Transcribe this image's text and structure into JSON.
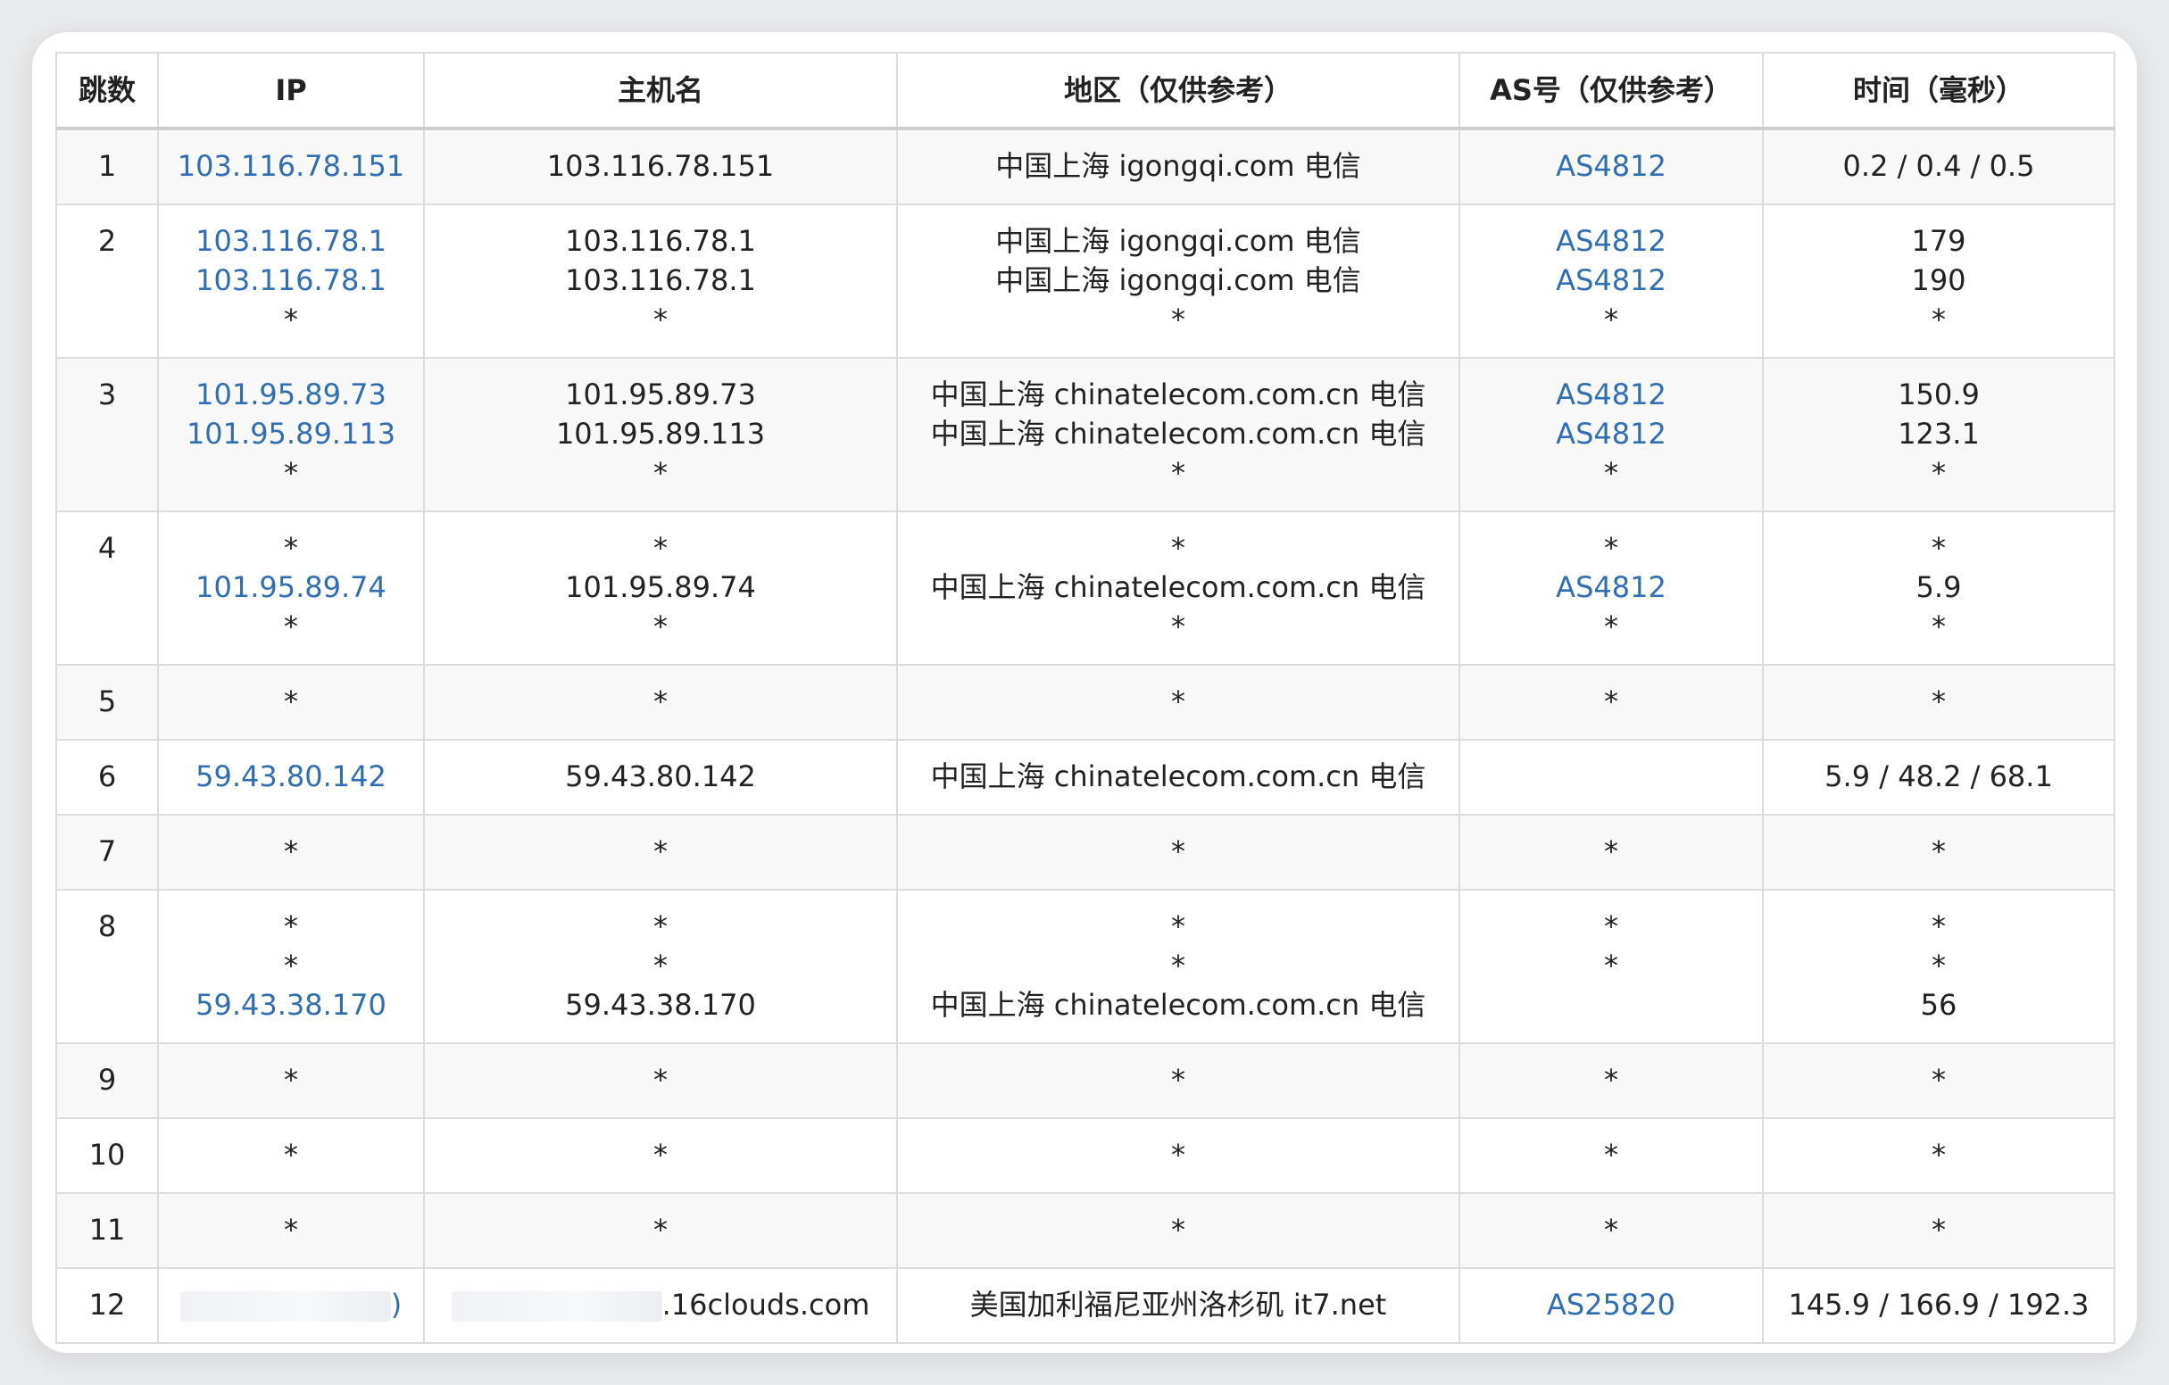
{
  "headers": {
    "hop": "跳数",
    "ip": "IP",
    "hostname": "主机名",
    "region": "地区（仅供参考）",
    "as": "AS号（仅供参考）",
    "time": "时间（毫秒）"
  },
  "rows": [
    {
      "hop": "1",
      "lines": 1,
      "ip": [
        "103.116.78.151"
      ],
      "host": [
        "103.116.78.151"
      ],
      "region": [
        "中国上海 igongqi.com 电信"
      ],
      "as": [
        "AS4812"
      ],
      "time": [
        "0.2 / 0.4 / 0.5"
      ]
    },
    {
      "hop": "2",
      "lines": 3,
      "ip": [
        "103.116.78.1",
        "103.116.78.1",
        "*"
      ],
      "host": [
        "103.116.78.1",
        "103.116.78.1",
        "*"
      ],
      "region": [
        "中国上海 igongqi.com 电信",
        "中国上海 igongqi.com 电信",
        "*"
      ],
      "as": [
        "AS4812",
        "AS4812",
        "*"
      ],
      "time": [
        "179",
        "190",
        "*"
      ]
    },
    {
      "hop": "3",
      "lines": 3,
      "ip": [
        "101.95.89.73",
        "101.95.89.113",
        "*"
      ],
      "host": [
        "101.95.89.73",
        "101.95.89.113",
        "*"
      ],
      "region": [
        "中国上海 chinatelecom.com.cn 电信",
        "中国上海 chinatelecom.com.cn 电信",
        "*"
      ],
      "as": [
        "AS4812",
        "AS4812",
        "*"
      ],
      "time": [
        "150.9",
        "123.1",
        "*"
      ]
    },
    {
      "hop": "4",
      "lines": 3,
      "ip": [
        "*",
        "101.95.89.74",
        "*"
      ],
      "host": [
        "*",
        "101.95.89.74",
        "*"
      ],
      "region": [
        "*",
        "中国上海 chinatelecom.com.cn 电信",
        "*"
      ],
      "as": [
        "*",
        "AS4812",
        "*"
      ],
      "time": [
        "*",
        "5.9",
        "*"
      ]
    },
    {
      "hop": "5",
      "lines": 1,
      "ip": [
        "*"
      ],
      "host": [
        "*"
      ],
      "region": [
        "*"
      ],
      "as": [
        "*"
      ],
      "time": [
        "*"
      ]
    },
    {
      "hop": "6",
      "lines": 1,
      "ip": [
        "59.43.80.142"
      ],
      "host": [
        "59.43.80.142"
      ],
      "region": [
        "中国上海 chinatelecom.com.cn 电信"
      ],
      "as": [
        ""
      ],
      "time": [
        "5.9 / 48.2 / 68.1"
      ]
    },
    {
      "hop": "7",
      "lines": 1,
      "ip": [
        "*"
      ],
      "host": [
        "*"
      ],
      "region": [
        "*"
      ],
      "as": [
        "*"
      ],
      "time": [
        "*"
      ]
    },
    {
      "hop": "8",
      "lines": 3,
      "ip": [
        "*",
        "*",
        "59.43.38.170"
      ],
      "host": [
        "*",
        "*",
        "59.43.38.170"
      ],
      "region": [
        "*",
        "*",
        "中国上海 chinatelecom.com.cn 电信"
      ],
      "as": [
        "*",
        "*",
        ""
      ],
      "time": [
        "*",
        "*",
        "56"
      ]
    },
    {
      "hop": "9",
      "lines": 1,
      "ip": [
        "*"
      ],
      "host": [
        "*"
      ],
      "region": [
        "*"
      ],
      "as": [
        "*"
      ],
      "time": [
        "*"
      ]
    },
    {
      "hop": "10",
      "lines": 1,
      "ip": [
        "*"
      ],
      "host": [
        "*"
      ],
      "region": [
        "*"
      ],
      "as": [
        "*"
      ],
      "time": [
        "*"
      ]
    },
    {
      "hop": "11",
      "lines": 1,
      "ip": [
        "*"
      ],
      "host": [
        "*"
      ],
      "region": [
        "*"
      ],
      "as": [
        "*"
      ],
      "time": [
        "*"
      ]
    },
    {
      "hop": "12",
      "lines": 1,
      "ip_redacted": true,
      "ip_tail": ")",
      "host_redacted": true,
      "host_tail": ".16clouds.com",
      "region": [
        "美国加利福尼亚州洛杉矶 it7.net"
      ],
      "as": [
        "AS25820"
      ],
      "time": [
        "145.9 / 166.9 / 192.3"
      ]
    }
  ],
  "colors": {
    "link": "#2f6eb5",
    "text": "#222222",
    "border": "#dcdcdc",
    "stripe": "#f8f8f8"
  }
}
